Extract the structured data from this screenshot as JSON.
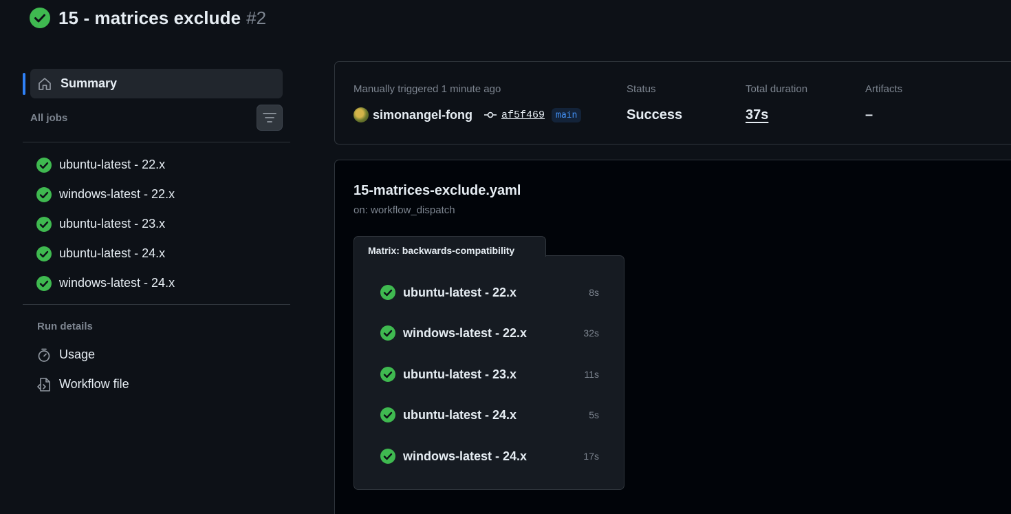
{
  "header": {
    "title": "15 - matrices exclude",
    "run_number": "#2"
  },
  "colors": {
    "success": "#3fb950",
    "accent": "#2f81f7",
    "background": "#0d1117"
  },
  "sidebar": {
    "summary_label": "Summary",
    "all_jobs_label": "All jobs",
    "jobs": [
      {
        "label": "ubuntu-latest - 22.x",
        "icon": "check-circle-icon"
      },
      {
        "label": "windows-latest - 22.x",
        "icon": "check-circle-icon"
      },
      {
        "label": "ubuntu-latest - 23.x",
        "icon": "check-circle-icon"
      },
      {
        "label": "ubuntu-latest - 24.x",
        "icon": "check-circle-icon"
      },
      {
        "label": "windows-latest - 24.x",
        "icon": "check-circle-icon"
      }
    ],
    "run_details_title": "Run details",
    "details": [
      {
        "label": "Usage",
        "icon": "stopwatch-icon"
      },
      {
        "label": "Workflow file",
        "icon": "file-code-icon"
      }
    ]
  },
  "summary": {
    "trigger_label": "Manually triggered 1 minute ago",
    "username": "simonangel-fong",
    "commit": "af5f469",
    "branch": "main",
    "status_label": "Status",
    "status_value": "Success",
    "duration_label": "Total duration",
    "duration_value": "37s",
    "artifacts_label": "Artifacts",
    "artifacts_value": "–"
  },
  "workflow": {
    "filename": "15-matrices-exclude.yaml",
    "trigger": "on: workflow_dispatch",
    "matrix_title": "Matrix: backwards-compatibility",
    "jobs": [
      {
        "label": "ubuntu-latest - 22.x",
        "time": "8s"
      },
      {
        "label": "windows-latest - 22.x",
        "time": "32s"
      },
      {
        "label": "ubuntu-latest - 23.x",
        "time": "11s"
      },
      {
        "label": "ubuntu-latest - 24.x",
        "time": "5s"
      },
      {
        "label": "windows-latest - 24.x",
        "time": "17s"
      }
    ]
  }
}
